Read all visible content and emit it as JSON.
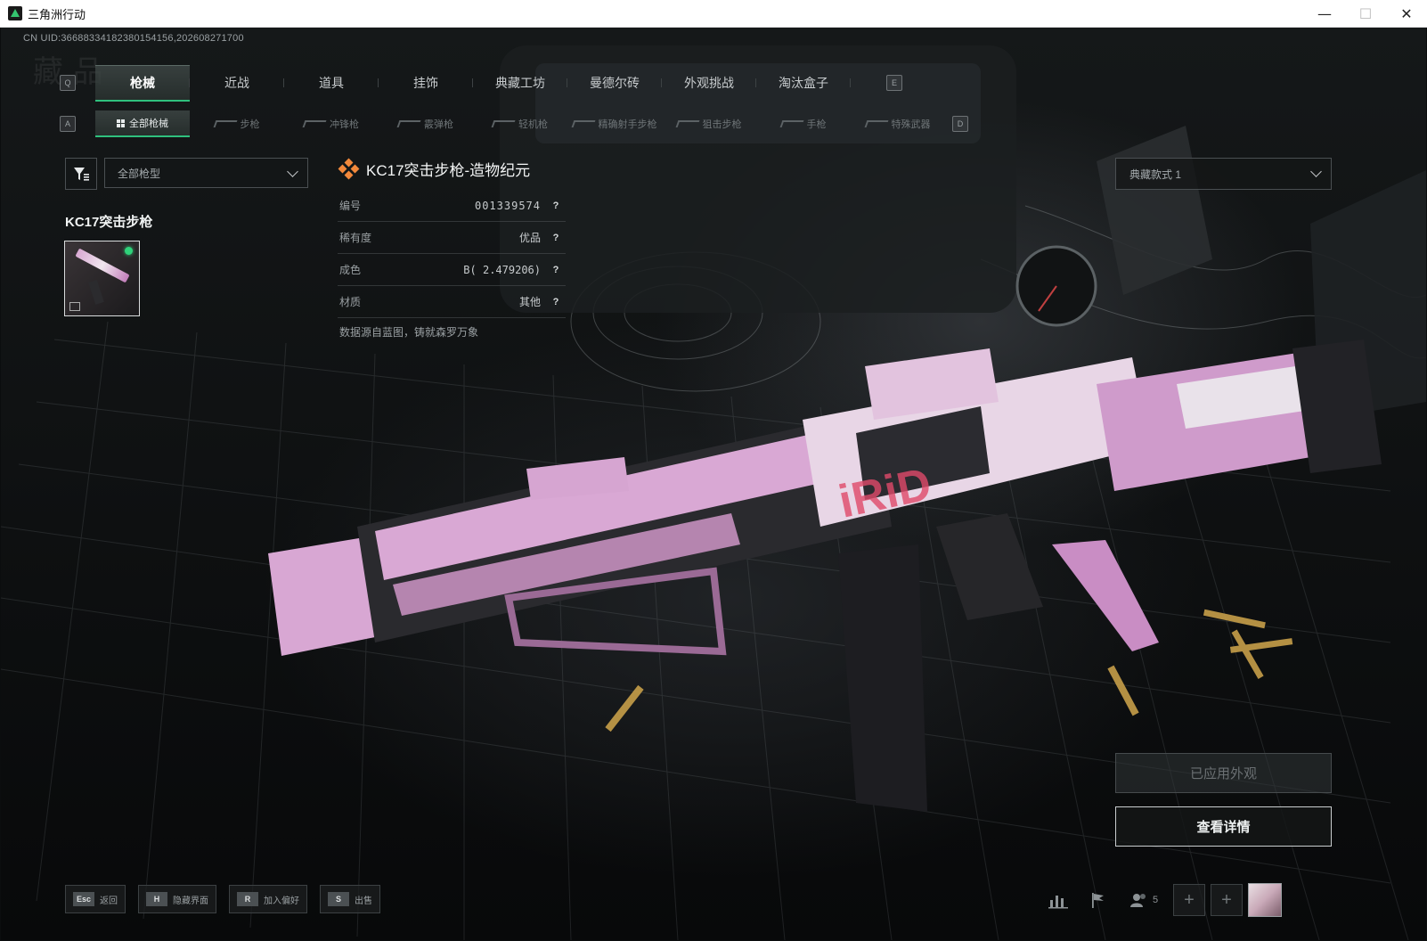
{
  "window": {
    "title": "三角洲行动",
    "min": "—",
    "max": "☐",
    "close": "✕"
  },
  "uid": "CN UID:3668833418238015415​6,2026082717​00",
  "main_tabs": {
    "key_left": "Q",
    "key_right": "E",
    "items": [
      "枪械",
      "近战",
      "道具",
      "挂饰",
      "典藏工坊",
      "曼德尔砖",
      "外观挑战",
      "淘汰盒子"
    ]
  },
  "sub_tabs": {
    "key_left": "A",
    "key_right": "D",
    "items": [
      "全部枪械",
      "步枪",
      "冲锋枪",
      "霰弹枪",
      "轻机枪",
      "精确射手步枪",
      "狙击步枪",
      "手枪",
      "特殊武器"
    ]
  },
  "filter": {
    "gun_type": "全部枪型"
  },
  "weapon_group": "KC17突击步枪",
  "detail": {
    "title": "KC17突击步枪-造物纪元",
    "rows": [
      {
        "label": "编号",
        "value": "001339574",
        "help": "?"
      },
      {
        "label": "稀有度",
        "value": "优品",
        "help": "?"
      },
      {
        "label": "成色",
        "value": "B( 2.479206)",
        "help": "?"
      },
      {
        "label": "材质",
        "value": "其他",
        "help": "?"
      }
    ],
    "flavor": "数据源自蓝图，铸就森罗万象"
  },
  "style_select": "典藏款式 1",
  "buttons": {
    "applied": "已应用外观",
    "details": "查看详情"
  },
  "bottom_hints": [
    {
      "key": "Esc",
      "label": "返回"
    },
    {
      "key": "H",
      "label": "隐藏界面"
    },
    {
      "key": "R",
      "label": "加入偏好"
    },
    {
      "key": "S",
      "label": "出售"
    }
  ],
  "bottom_right": {
    "friends_count": "5",
    "add": "+"
  },
  "colors": {
    "accent": "#2fc07d",
    "rarity": "#f2883b",
    "skin_pink": "#d8a7d3"
  },
  "icons": [
    "app-icon",
    "filter-icon",
    "chevron-down-icon",
    "rarity-diamond-icon",
    "stats-icon",
    "flag-icon",
    "friends-icon",
    "plus-icon"
  ]
}
